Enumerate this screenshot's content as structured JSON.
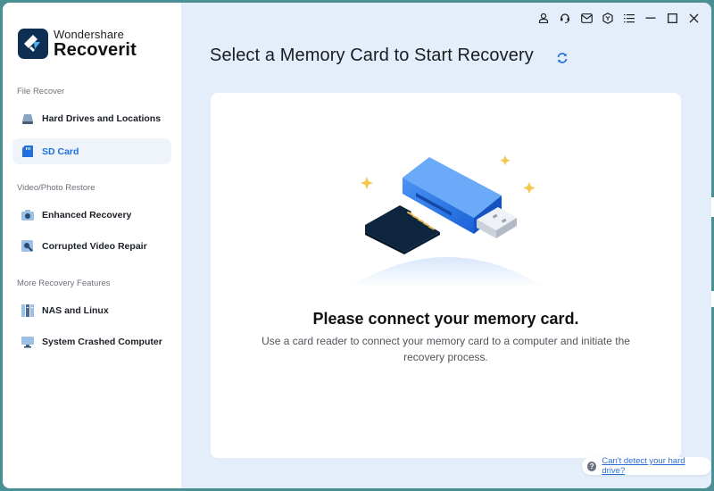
{
  "app": {
    "brand_top": "Wondershare",
    "brand_main": "Recoverit"
  },
  "colors": {
    "accent": "#1f6fe0",
    "sidebar_bg": "#ffffff",
    "main_bg": "#e4eefb",
    "frame": "#4a8f93",
    "logo_bg": "#0e2e52"
  },
  "topbar": {
    "icons": [
      "account-icon",
      "support-headset-icon",
      "mail-icon",
      "cube-icon",
      "menu-list-icon",
      "minimize-icon",
      "maximize-icon",
      "close-icon"
    ]
  },
  "sidebar": {
    "sections": [
      {
        "label": "File Recover",
        "items": [
          {
            "label": "Hard Drives and Locations",
            "icon": "hard-drive-icon",
            "active": false
          },
          {
            "label": "SD Card",
            "icon": "sd-card-icon",
            "active": true
          }
        ]
      },
      {
        "label": "Video/Photo Restore",
        "items": [
          {
            "label": "Enhanced Recovery",
            "icon": "camera-icon",
            "active": false
          },
          {
            "label": "Corrupted Video Repair",
            "icon": "repair-wrench-icon",
            "active": false
          }
        ]
      },
      {
        "label": "More Recovery Features",
        "items": [
          {
            "label": "NAS and Linux",
            "icon": "nas-server-icon",
            "active": false
          },
          {
            "label": "System Crashed Computer",
            "icon": "monitor-icon",
            "active": false
          }
        ]
      }
    ]
  },
  "main": {
    "title": "Select a Memory Card to Start Recovery",
    "card": {
      "heading": "Please connect your memory card.",
      "description": "Use a card reader to connect your memory card to a computer and initiate the recovery process."
    },
    "help_link": "Can't detect your hard drive?"
  }
}
